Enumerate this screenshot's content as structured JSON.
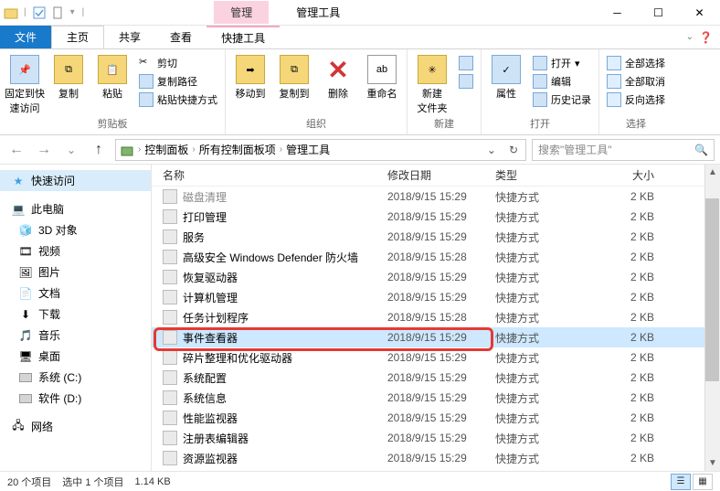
{
  "titlebar": {
    "context_tab1": "管理",
    "context_tab2": "管理工具"
  },
  "ribbon_tabs": {
    "file": "文件",
    "home": "主页",
    "share": "共享",
    "view": "查看",
    "shortcut_tools": "快捷工具"
  },
  "ribbon": {
    "clipboard": {
      "pin": "固定到快\n速访问",
      "copy": "复制",
      "paste": "粘贴",
      "cut": "剪切",
      "copy_path": "复制路径",
      "paste_shortcut": "粘贴快捷方式",
      "label": "剪贴板"
    },
    "organize": {
      "move_to": "移动到",
      "copy_to": "复制到",
      "delete": "删除",
      "rename": "重命名",
      "label": "组织"
    },
    "new": {
      "new_folder": "新建\n文件夹",
      "label": "新建"
    },
    "open": {
      "properties": "属性",
      "open": "打开",
      "edit": "编辑",
      "history": "历史记录",
      "label": "打开"
    },
    "select": {
      "select_all": "全部选择",
      "select_none": "全部取消",
      "invert": "反向选择",
      "label": "选择"
    }
  },
  "address": {
    "segments": [
      "控制面板",
      "所有控制面板项",
      "管理工具"
    ],
    "search_placeholder": "搜索\"管理工具\""
  },
  "nav": {
    "quick_access": "快速访问",
    "this_pc": "此电脑",
    "objects_3d": "3D 对象",
    "videos": "视频",
    "pictures": "图片",
    "documents": "文档",
    "downloads": "下载",
    "music": "音乐",
    "desktop": "桌面",
    "drive_c": "系统 (C:)",
    "drive_d": "软件 (D:)",
    "network": "网络"
  },
  "columns": {
    "name": "名称",
    "date": "修改日期",
    "type": "类型",
    "size": "大小"
  },
  "files": [
    {
      "name": "磁盘清理",
      "date": "2018/9/15 15:29",
      "type": "快捷方式",
      "size": "2 KB",
      "truncated": true
    },
    {
      "name": "打印管理",
      "date": "2018/9/15 15:29",
      "type": "快捷方式",
      "size": "2 KB"
    },
    {
      "name": "服务",
      "date": "2018/9/15 15:29",
      "type": "快捷方式",
      "size": "2 KB"
    },
    {
      "name": "高级安全 Windows Defender 防火墙",
      "date": "2018/9/15 15:28",
      "type": "快捷方式",
      "size": "2 KB"
    },
    {
      "name": "恢复驱动器",
      "date": "2018/9/15 15:29",
      "type": "快捷方式",
      "size": "2 KB"
    },
    {
      "name": "计算机管理",
      "date": "2018/9/15 15:29",
      "type": "快捷方式",
      "size": "2 KB"
    },
    {
      "name": "任务计划程序",
      "date": "2018/9/15 15:28",
      "type": "快捷方式",
      "size": "2 KB"
    },
    {
      "name": "事件查看器",
      "date": "2018/9/15 15:29",
      "type": "快捷方式",
      "size": "2 KB",
      "selected": true
    },
    {
      "name": "碎片整理和优化驱动器",
      "date": "2018/9/15 15:29",
      "type": "快捷方式",
      "size": "2 KB"
    },
    {
      "name": "系统配置",
      "date": "2018/9/15 15:29",
      "type": "快捷方式",
      "size": "2 KB"
    },
    {
      "name": "系统信息",
      "date": "2018/9/15 15:29",
      "type": "快捷方式",
      "size": "2 KB"
    },
    {
      "name": "性能监视器",
      "date": "2018/9/15 15:29",
      "type": "快捷方式",
      "size": "2 KB"
    },
    {
      "name": "注册表编辑器",
      "date": "2018/9/15 15:29",
      "type": "快捷方式",
      "size": "2 KB"
    },
    {
      "name": "资源监视器",
      "date": "2018/9/15 15:29",
      "type": "快捷方式",
      "size": "2 KB"
    }
  ],
  "status": {
    "count": "20 个项目",
    "selection": "选中 1 个项目",
    "size": "1.14 KB"
  }
}
